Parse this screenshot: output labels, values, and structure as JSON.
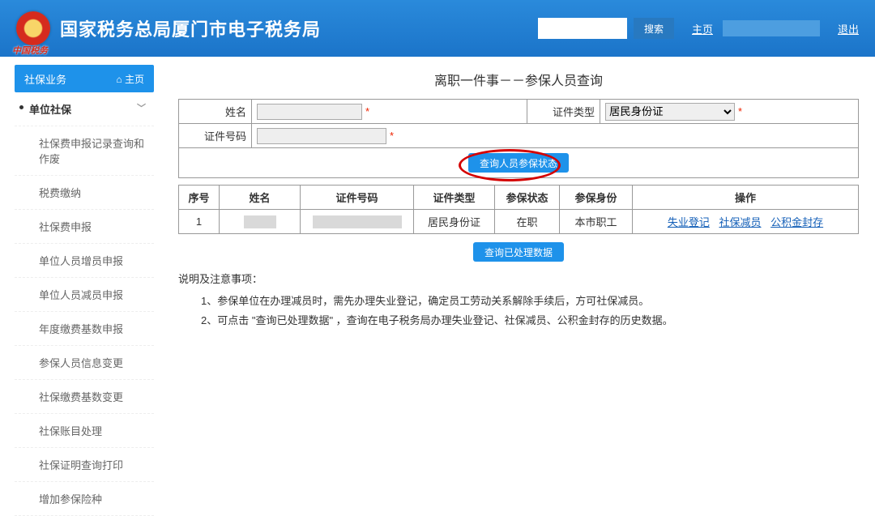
{
  "header": {
    "title": "国家税务总局厦门市电子税务局",
    "search_placeholder": "",
    "search_btn": "搜索",
    "home_link": "主页",
    "logout": "退出",
    "emblem_sub": "中国税务"
  },
  "sidebar": {
    "head": "社保业务",
    "home": "主页",
    "parent": "单位社保",
    "items": [
      "社保费申报记录查询和作废",
      "税费缴纳",
      "社保费申报",
      "单位人员增员申报",
      "单位人员减员申报",
      "年度缴费基数申报",
      "参保人员信息变更",
      "社保缴费基数变更",
      "社保账目处理",
      "社保证明查询打印",
      "增加参保险种"
    ]
  },
  "page": {
    "title": "离职一件事－－参保人员查询",
    "form": {
      "name_label": "姓名",
      "id_type_label": "证件类型",
      "id_type_value": "居民身份证",
      "id_no_label": "证件号码"
    },
    "query_btn": "查询人员参保状态",
    "processed_btn": "查询已处理数据",
    "table": {
      "headers": [
        "序号",
        "姓名",
        "证件号码",
        "证件类型",
        "参保状态",
        "参保身份",
        "操作"
      ],
      "row": {
        "seq": "1",
        "name": "",
        "idno": "",
        "id_type": "居民身份证",
        "status": "在职",
        "identity": "本市职工",
        "ops": [
          "失业登记",
          "社保减员",
          "公积金封存"
        ]
      }
    },
    "notes": {
      "title": "说明及注意事项：",
      "items": [
        "1、参保单位在办理减员时，需先办理失业登记，确定员工劳动关系解除手续后，方可社保减员。",
        "2、可点击 \"查询已处理数据\" ，查询在电子税务局办理失业登记、社保减员、公积金封存的历史数据。"
      ]
    }
  }
}
